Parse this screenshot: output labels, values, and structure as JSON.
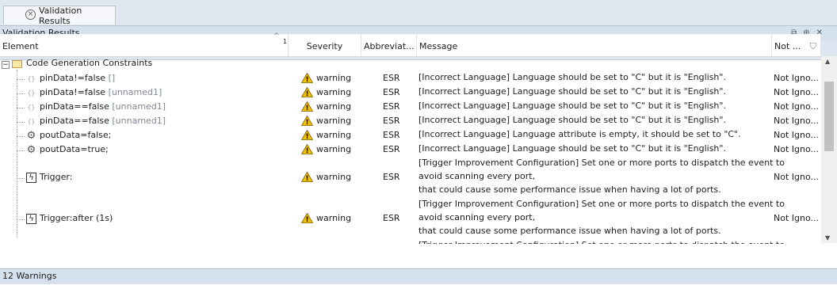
{
  "tab": {
    "label": "Validation Results"
  },
  "panel": {
    "title": "Validation Results"
  },
  "columns": {
    "element": "Element",
    "sort_number": "1",
    "severity": "Severity",
    "abbreviation": "Abbreviat...",
    "message": "Message",
    "not_ignored": "Not ..."
  },
  "group": {
    "label": "Code Generation Constraints"
  },
  "rows": [
    {
      "name": "pinData!=false",
      "suffix": "[]",
      "icon": "pin-icon",
      "severity": "warning",
      "abbr": "ESR",
      "message": [
        "[Incorrect Language] Language should be set to \"C\" but it is \"English\"."
      ],
      "not": "Not Igno..."
    },
    {
      "name": "pinData!=false",
      "suffix": "[unnamed1]",
      "icon": "pin-icon",
      "severity": "warning",
      "abbr": "ESR",
      "message": [
        "[Incorrect Language] Language should be set to \"C\" but it is \"English\"."
      ],
      "not": "Not Igno..."
    },
    {
      "name": "pinData==false",
      "suffix": "[unnamed1]",
      "icon": "pin-icon",
      "severity": "warning",
      "abbr": "ESR",
      "message": [
        "[Incorrect Language] Language should be set to \"C\" but it is \"English\"."
      ],
      "not": "Not Igno..."
    },
    {
      "name": "pinData==false",
      "suffix": "[unnamed1]",
      "icon": "pin-icon",
      "severity": "warning",
      "abbr": "ESR",
      "message": [
        "[Incorrect Language] Language should be set to \"C\" but it is \"English\"."
      ],
      "not": "Not Igno..."
    },
    {
      "name": "poutData=false;",
      "suffix": "",
      "icon": "opaque-action-icon",
      "severity": "warning",
      "abbr": "ESR",
      "message": [
        "[Incorrect Language] Language attribute is empty, it should be set to \"C\"."
      ],
      "not": "Not Igno..."
    },
    {
      "name": "poutData=true;",
      "suffix": "",
      "icon": "opaque-action-icon",
      "severity": "warning",
      "abbr": "ESR",
      "message": [
        "[Incorrect Language] Language should be set to \"C\" but it is \"English\"."
      ],
      "not": "Not Igno..."
    },
    {
      "name": "Trigger:",
      "suffix": "",
      "icon": "trigger-icon",
      "severity": "warning",
      "abbr": "ESR",
      "message": [
        "[Trigger Improvement Configuration] Set one or more ports to dispatch the event to",
        "avoid scanning every port,",
        "that could cause some performance issue when having a lot of ports."
      ],
      "not": "Not Igno..."
    },
    {
      "name": "Trigger:after (1s)",
      "suffix": "",
      "icon": "trigger-icon",
      "severity": "warning",
      "abbr": "ESR",
      "message": [
        "[Trigger Improvement Configuration] Set one or more ports to dispatch the event to",
        "avoid scanning every port,",
        "that could cause some performance issue when having a lot of ports."
      ],
      "not": "Not Igno..."
    },
    {
      "name": "",
      "suffix": "",
      "icon": "",
      "severity": "",
      "abbr": "",
      "message": [
        "[Trigger Improvement Configuration] Set one or more ports to dispatch the event to"
      ],
      "not": ""
    }
  ],
  "status": {
    "text": "12 Warnings"
  },
  "colors": {
    "warning": "#f2c200",
    "title_bar": "#d6e1ee",
    "toolbar": "#dce5f0"
  }
}
